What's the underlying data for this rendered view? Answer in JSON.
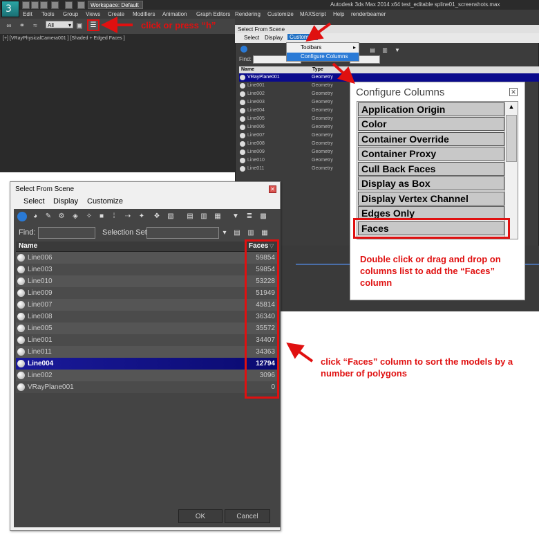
{
  "app": {
    "title": "Autodesk 3ds Max  2014 x64     test_editable spline01_screenshots.max",
    "workspace": "Workspace: Default",
    "menu": [
      "Edit",
      "Tools",
      "Group",
      "Views",
      "Create",
      "Modifiers",
      "Animation",
      "Graph Editors",
      "Rendering",
      "Customize",
      "MAXScript",
      "Help",
      "renderbeamer"
    ],
    "selection_filter": "All",
    "viewport_label": "[+] [VRayPhysicalCamera001 ] [Shaded + Edged Faces ]"
  },
  "bg_dialog": {
    "title": "Select From Scene",
    "menu": [
      "Select",
      "Display",
      "Customize"
    ],
    "find_label": "Find:",
    "columns": {
      "name": "Name",
      "type": "Type"
    },
    "rows": [
      {
        "name": "VRayPlane001",
        "type": "Geometry",
        "selected": true
      },
      {
        "name": "Line001",
        "type": "Geometry"
      },
      {
        "name": "Line002",
        "type": "Geometry"
      },
      {
        "name": "Line003",
        "type": "Geometry"
      },
      {
        "name": "Line004",
        "type": "Geometry"
      },
      {
        "name": "Line005",
        "type": "Geometry"
      },
      {
        "name": "Line006",
        "type": "Geometry"
      },
      {
        "name": "Line007",
        "type": "Geometry"
      },
      {
        "name": "Line008",
        "type": "Geometry"
      },
      {
        "name": "Line009",
        "type": "Geometry"
      },
      {
        "name": "Line010",
        "type": "Geometry"
      },
      {
        "name": "Line011",
        "type": "Geometry"
      }
    ],
    "customize_menu": {
      "toolbars": "Toolbars",
      "configure_columns": "Configure Columns"
    }
  },
  "configure_columns": {
    "title": "Configure Columns",
    "items": [
      "Application Origin",
      "Color",
      "Container Override",
      "Container Proxy",
      "Cull Back Faces",
      "Display as Box",
      "Display Vertex Channel",
      "Edges Only",
      "Faces"
    ]
  },
  "main_dialog": {
    "title": "Select From Scene",
    "menu": [
      "Select",
      "Display",
      "Customize"
    ],
    "find_label": "Find:",
    "selection_set_label": "Selection Set:",
    "columns": {
      "name": "Name",
      "faces": "Faces"
    },
    "rows": [
      {
        "name": "Line006",
        "faces": "59854"
      },
      {
        "name": "Line003",
        "faces": "59854"
      },
      {
        "name": "Line010",
        "faces": "53228"
      },
      {
        "name": "Line009",
        "faces": "51949"
      },
      {
        "name": "Line007",
        "faces": "45814"
      },
      {
        "name": "Line008",
        "faces": "36340"
      },
      {
        "name": "Line005",
        "faces": "35572"
      },
      {
        "name": "Line001",
        "faces": "34407"
      },
      {
        "name": "Line011",
        "faces": "34363"
      },
      {
        "name": "Line004",
        "faces": "12794",
        "selected": true
      },
      {
        "name": "Line002",
        "faces": "3096"
      },
      {
        "name": "VRayPlane001",
        "faces": "0"
      }
    ],
    "ok": "OK",
    "cancel": "Cancel"
  },
  "annotations": {
    "press_h": "click or press “h”",
    "faces_note": "Double click or drag and drop on columns list to add the “Faces” column",
    "sort_note": "click “Faces” column to sort the models by a number of polygons"
  },
  "colors": {
    "annotation": "#e01010",
    "selection": "#0a0a8c",
    "max_dark": "#3b3b3b"
  }
}
